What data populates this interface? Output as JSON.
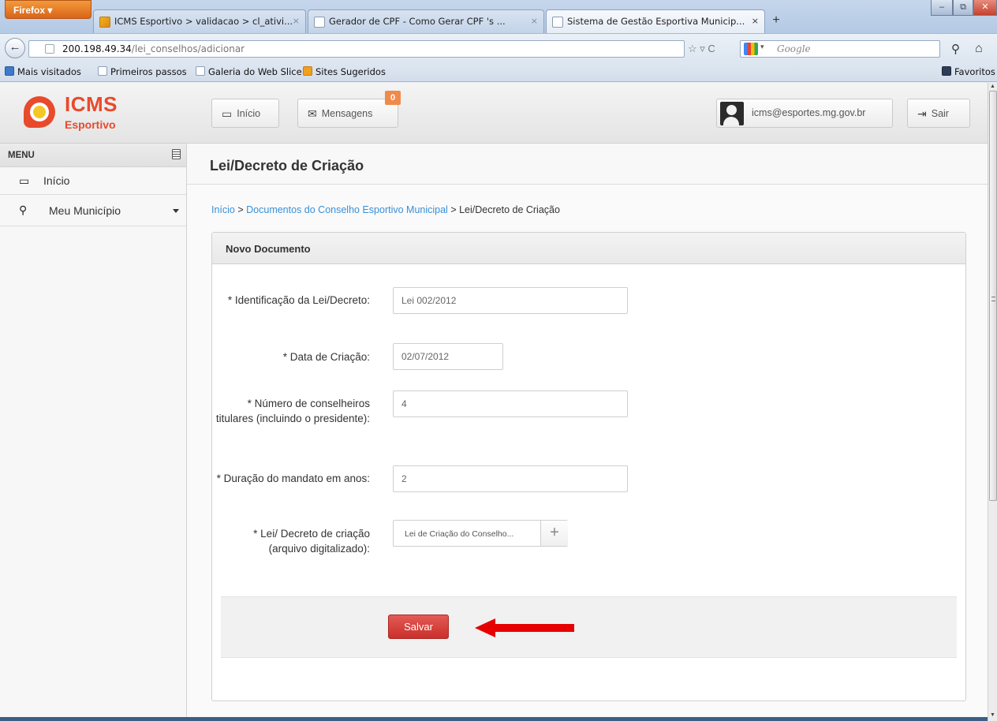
{
  "browser": {
    "menu_button": "Firefox ▾",
    "tabs": [
      {
        "title": "ICMS Esportivo > validacao > cl_ativi...",
        "close": "×"
      },
      {
        "title": "Gerador de CPF - Como Gerar CPF 's ...",
        "close": "×"
      },
      {
        "title": "Sistema de Gestão Esportiva Municip...",
        "close": "×"
      }
    ],
    "new_tab": "+",
    "window_buttons": {
      "minimize": "–",
      "maximize": "⧉",
      "close": "✕"
    },
    "back": "←",
    "url_host": "200.198.49.34",
    "url_path": "/lei_conselhos/adicionar",
    "url_tools": "☆ ▿ C",
    "search_placeholder": "Google",
    "search_go": "⚲",
    "home": "⌂",
    "bookmarks": [
      "Mais visitados",
      "Primeiros passos",
      "Galeria do Web Slice",
      "Sites Sugeridos"
    ],
    "favorites": "Favoritos"
  },
  "header": {
    "logo_title": "ICMS",
    "logo_sub": "Esportivo",
    "inicio_label": "Início",
    "mensagens_label": "Mensagens",
    "mensagens_count": "0",
    "user_email": "icms@esportes.mg.gov.br",
    "sair_label": "Sair",
    "icons": {
      "inicio": "monitor-icon",
      "mensagens": "envelope-icon",
      "sair": "logout-icon"
    }
  },
  "sidebar": {
    "menu_title": "MENU",
    "items": [
      {
        "label": "Início",
        "icon": "monitor-icon"
      },
      {
        "label": "Meu Município",
        "icon": "map-marker-icon"
      }
    ]
  },
  "main": {
    "page_title": "Lei/Decreto de Criação",
    "breadcrumb": {
      "home": "Início",
      "sep1": " > ",
      "parent": "Documentos do Conselho Esportivo Municipal",
      "sep2": " > ",
      "current": "Lei/Decreto de Criação"
    },
    "card_title": "Novo Documento",
    "fields": {
      "identificacao": {
        "label": "* Identificação da Lei/Decreto:",
        "value": "Lei 002/2012"
      },
      "data": {
        "label": "* Data de Criação:",
        "value": "02/07/2012"
      },
      "conselheiros": {
        "label": "* Número de conselheiros titulares (incluindo o presidente):",
        "value": "4"
      },
      "duracao": {
        "label": "* Duração do mandato em anos:",
        "value": "2"
      },
      "arquivo": {
        "label": "* Lei/ Decreto de criação (arquivo digitalizado):",
        "file_name": "Lei de Criação do Conselho...",
        "add": "+"
      }
    },
    "save_label": "Salvar"
  },
  "colors": {
    "accent": "#e84a2c",
    "link": "#3a8fd8",
    "save": "#c9302c",
    "arrow": "#e60000"
  }
}
